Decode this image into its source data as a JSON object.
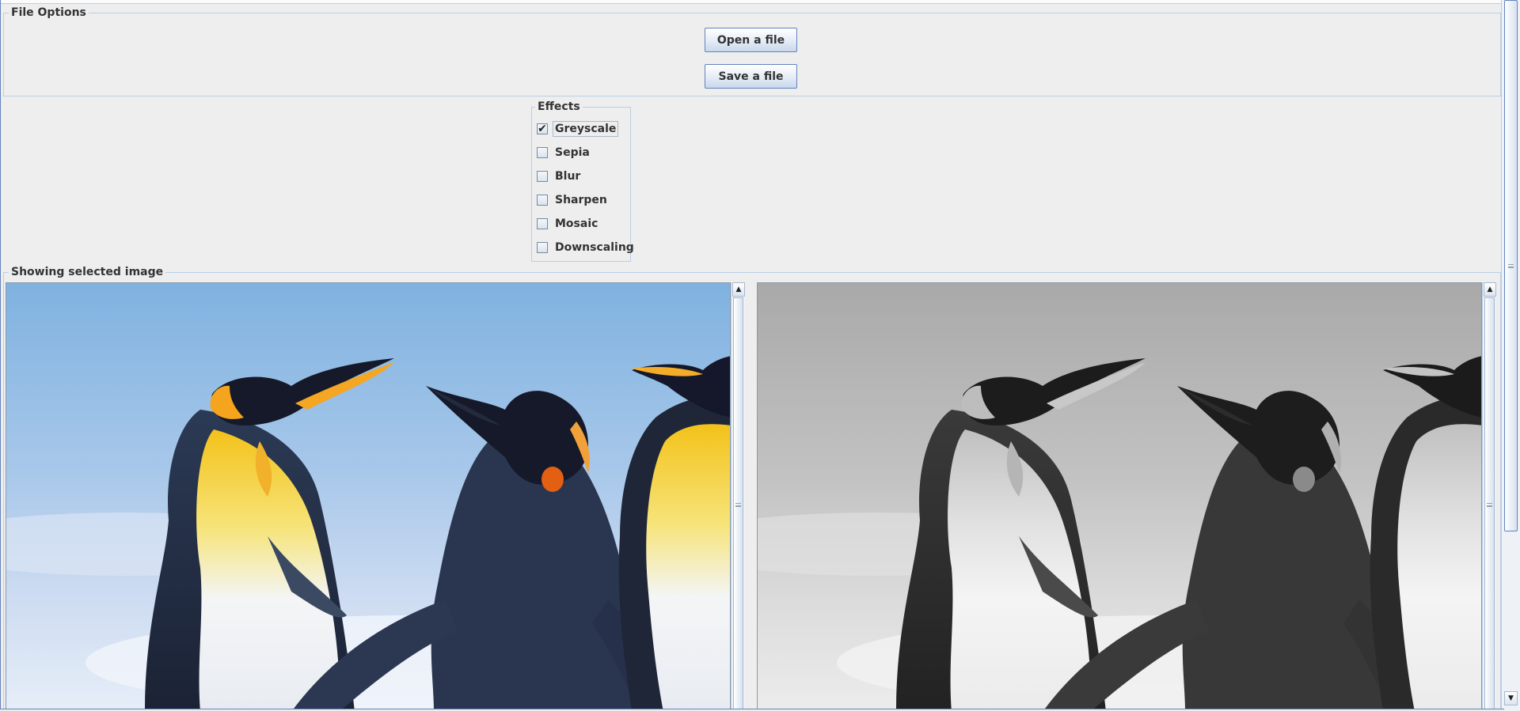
{
  "file_options": {
    "title": "File Options",
    "open_label": "Open a file",
    "save_label": "Save a file"
  },
  "effects": {
    "title": "Effects",
    "items": [
      {
        "label": "Greyscale",
        "checked": true
      },
      {
        "label": "Sepia",
        "checked": false
      },
      {
        "label": "Blur",
        "checked": false
      },
      {
        "label": "Sharpen",
        "checked": false
      },
      {
        "label": "Mosaic",
        "checked": false
      },
      {
        "label": "Downscaling",
        "checked": false
      }
    ]
  },
  "viewer": {
    "title": "Showing selected image"
  },
  "icons": {
    "scroll_up": "triangle-up-icon",
    "scroll_down": "triangle-down-icon",
    "check_mark": "check-mark-icon"
  },
  "colors": {
    "background": "#eeeeee",
    "border": "#b8cfe5",
    "button_border": "#6382bf"
  }
}
